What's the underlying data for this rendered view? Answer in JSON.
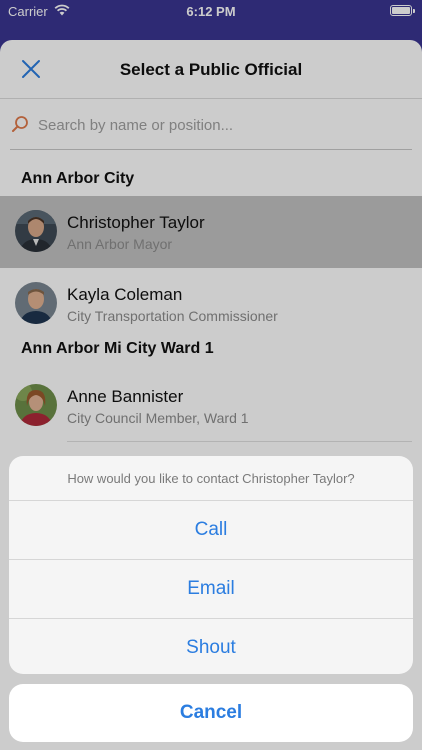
{
  "status_bar": {
    "carrier": "Carrier",
    "time": "6:12 PM"
  },
  "header": {
    "title": "Select a Public Official"
  },
  "search": {
    "placeholder": "Search by name or position..."
  },
  "sections": [
    {
      "title": "Ann Arbor City",
      "officials": [
        {
          "name": "Christopher Taylor",
          "position": "Ann Arbor Mayor"
        },
        {
          "name": "Kayla Coleman",
          "position": "City Transportation Commissioner"
        }
      ]
    },
    {
      "title": "Ann Arbor Mi City Ward 1",
      "officials": [
        {
          "name": "Anne Bannister",
          "position": "City Council Member, Ward 1"
        }
      ]
    }
  ],
  "action_sheet": {
    "title": "How would you like to contact Christopher Taylor?",
    "actions": [
      "Call",
      "Email",
      "Shout"
    ],
    "cancel": "Cancel"
  },
  "colors": {
    "accent": "#2b7de0",
    "selected_row": "#c2c2c2",
    "status_bar": "#3a3591",
    "search_icon": "#e07a4a"
  }
}
